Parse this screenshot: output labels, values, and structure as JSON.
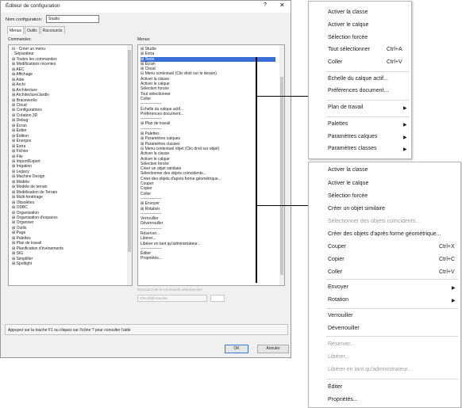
{
  "window": {
    "title": "Éditeur de configuration",
    "help_glyph": "?",
    "close_glyph": "✕"
  },
  "config": {
    "label": "Nom configuration:",
    "value": "Studio"
  },
  "tabs": [
    "Menus",
    "Outils",
    "Raccourcis"
  ],
  "commands": {
    "title": "Commandes:",
    "items": [
      "⊟ · Créer un menu",
      "· Séparateur",
      "⊞ Toutes les commandes",
      "",
      "⊞ Modifications récentes",
      "⊞ AEC",
      "⊞ Affichage",
      "⊞ Aide",
      "⊞ Archi",
      "⊞ Architecture",
      "⊞ Architecture/Jardin",
      "⊞ Braceworks",
      "⊞ Cloud",
      "⊞ Configurations",
      "⊞ Création 3D",
      "⊞ Debug",
      "⊞ Écran",
      "⊞ Éditer",
      "⊞ Édition",
      "⊞ Énergos",
      "⊞ Extra",
      "⊞ Fichier",
      "⊞ File",
      "⊞ Import/Export",
      "⊞ Irrigation",
      "⊞ Legacy",
      "⊞ Machine Design",
      "⊞ Modèle",
      "⊞ Modèle de terrain",
      "⊞ Modélisation de Terrain",
      "⊞ Multi-fenêtrage",
      "⊞ Obsolètes",
      "⊞ ODBC",
      "⊞ Organisation",
      "⊞ Organisation d'espaces",
      "⊞ Organiser",
      "⊞ Outils",
      "⊞ Page",
      "⊞ Palettes",
      "⊞ Plan de travail",
      "⊞ Planification d'événements",
      "⊞ SIG",
      "⊞ Simplifier",
      "⊞ Spotlight"
    ]
  },
  "menus": {
    "title": "Menus:",
    "items": [
      "⊞ Studio",
      "⊞ Extra",
      "⊞ Texte",
      "⊞ Écran",
      "⊞ Cloud",
      "⊟ Menu contextuel (Clic droit sur le dessin)",
      "     Activer la classe",
      "     Activer le calque",
      "     Sélection forcée",
      "     Tout sélectionner",
      "     Coller",
      "     ----------------",
      "     Échelle du calque actif...",
      "     Préférences document...",
      "     ----------------",
      "   ⊞ Plan de travail",
      "     ----------------",
      "   ⊞ Palettes",
      "   ⊞ Paramètres calques",
      "   ⊞ Paramètres classes",
      "⊟ Menu contextuel objet (Clic droit sur objet)",
      "     Activer la classe",
      "     Activer le calque",
      "     Sélection forcée",
      "     Créer un objet similaire",
      "     Sélectionner des objets coïncidents...",
      "     Créer des objets d'après forme géométrique...",
      "     Couper",
      "     Copier",
      "     Coller",
      "     ----------------",
      "   ⊞ Envoyer",
      "   ⊞ Rotation",
      "     ----------------",
      "     Verrouiller",
      "     Déverrouiller",
      "     ----------------",
      "     Réserver...",
      "     Libérer...",
      "     Libérer en tant qu'administrateur...",
      "     ----------------",
      "     Éditer",
      "     Propriétés..."
    ]
  },
  "shortcut": {
    "label": "Raccourci de la commande sélectionnée:",
    "value": "Ctrl+Shift+touche"
  },
  "status": "Appuyez sur la touche F1 ou cliquez sur l'icône ? pour consulter l'aide",
  "buttons": {
    "ok": "OK",
    "cancel": "Annuler"
  },
  "popup1": {
    "items": [
      {
        "label": "Activer la classe"
      },
      {
        "label": "Activer le calque"
      },
      {
        "label": "Sélection forcée"
      },
      {
        "label": "Tout sélectionner",
        "shortcut": "Ctrl+A"
      },
      {
        "label": "Coller",
        "shortcut": "Ctrl+V"
      },
      {
        "label": "Échelle du calque actif..."
      },
      {
        "label": "Préférences document..."
      },
      {
        "label": "Plan de travail",
        "submenu": true
      },
      {
        "label": "Palettes",
        "submenu": true
      },
      {
        "label": "Paramètres calques",
        "submenu": true
      },
      {
        "label": "Paramètres classes",
        "submenu": true
      }
    ]
  },
  "popup2": {
    "items": [
      {
        "label": "Activer la classe"
      },
      {
        "label": "Activer le calque"
      },
      {
        "label": "Sélection forcée"
      },
      {
        "label": "Créer un objet similaire"
      },
      {
        "label": "Sélectionner des objets coïncidents...",
        "disabled": true
      },
      {
        "label": "Créer des objets d'après forme géométrique..."
      },
      {
        "label": "Couper",
        "shortcut": "Ctrl+X"
      },
      {
        "label": "Copier",
        "shortcut": "Ctrl+C"
      },
      {
        "label": "Coller",
        "shortcut": "Ctrl+V"
      },
      {
        "label": "Envoyer",
        "submenu": true
      },
      {
        "label": "Rotation",
        "submenu": true
      },
      {
        "label": "Verrouiller"
      },
      {
        "label": "Déverrouiller"
      },
      {
        "label": "Réserver...",
        "disabled": true
      },
      {
        "label": "Libérer...",
        "disabled": true
      },
      {
        "label": "Libérer en tant qu'administrateur...",
        "disabled": true
      },
      {
        "label": "Éditer"
      },
      {
        "label": "Propriétés..."
      }
    ]
  },
  "colors": {
    "highlight": "#3a6fd8",
    "disabled_text": "#9e9e9e"
  }
}
